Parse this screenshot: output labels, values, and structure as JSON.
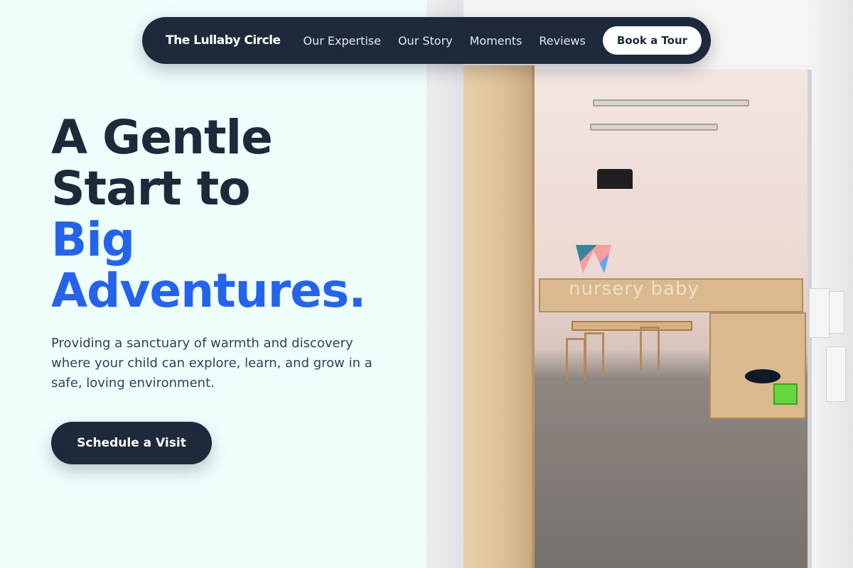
{
  "nav": {
    "brand": "The Lullaby Circle",
    "links": [
      "Our Expertise",
      "Our Story",
      "Moments",
      "Reviews"
    ],
    "cta_label": "Book a Tour"
  },
  "hero": {
    "headline_line1": "A Gentle",
    "headline_line2": "Start to",
    "headline_line3": "Big",
    "headline_line4": "Adventures.",
    "lead": "Providing a sanctuary of warmth and discovery where your child can explore, learn, and grow in a safe, loving environment.",
    "cta_label": "Schedule a Visit"
  },
  "photo": {
    "watermark": "nursery baby"
  },
  "colors": {
    "background": "#eefefd",
    "navy": "#1e293b",
    "accent_blue": "#2563eb",
    "white": "#ffffff"
  }
}
